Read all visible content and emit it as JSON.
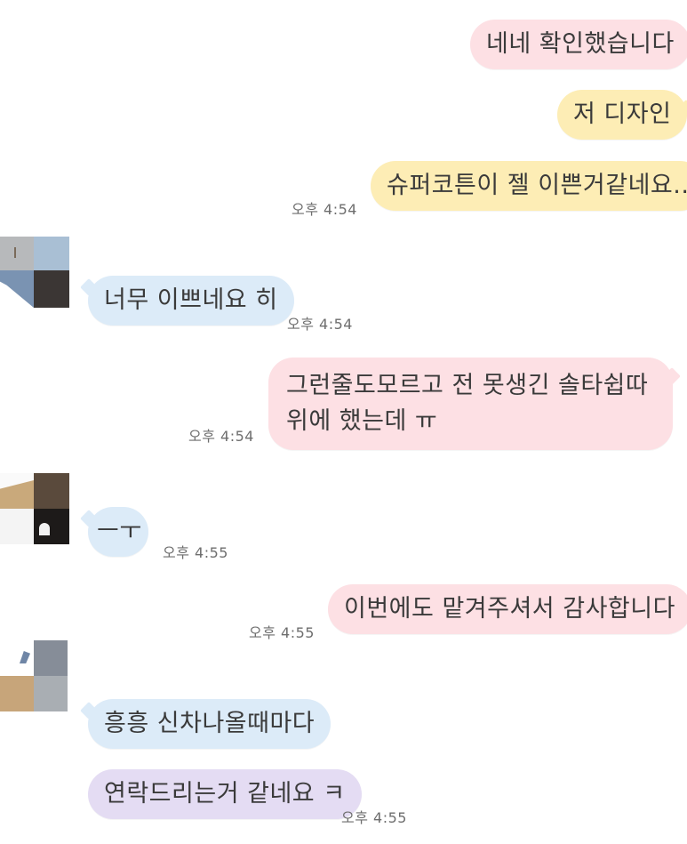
{
  "messages": [
    {
      "id": "m1",
      "side": "right",
      "text": "네네 확인했습니다"
    },
    {
      "id": "m2",
      "side": "right",
      "text": "저 디자인"
    },
    {
      "id": "m3",
      "side": "right",
      "text": "슈퍼코튼이 젤 이쁜거같네요..",
      "time": "오후 4:54"
    },
    {
      "id": "m4",
      "side": "left",
      "text": "너무 이쁘네요 히",
      "time": "오후 4:54"
    },
    {
      "id": "m5",
      "side": "right",
      "text": "그런줄도모르고 전 못생긴 솔타쉽따위에 했는데 ㅠ",
      "time": "오후 4:54"
    },
    {
      "id": "m6",
      "side": "left",
      "text": "ㅡㅜ",
      "time": "오후 4:55"
    },
    {
      "id": "m7",
      "side": "right",
      "text": "이번에도 맡겨주셔서 감사합니다",
      "time": "오후 4:55"
    },
    {
      "id": "m8",
      "side": "left",
      "text": "흥흥 신차나올때마다"
    },
    {
      "id": "m9",
      "side": "left",
      "text": "연락드리는거 같네요 ㅋ",
      "time": "오후 4:55"
    }
  ],
  "colors": {
    "pink": "#fde0e4",
    "yellow": "#fdedb5",
    "blue": "#dcebf8",
    "purple": "#e4dcf3",
    "timestamp": "#6e6e6e",
    "text": "#3a3a3a"
  },
  "avatars": [
    {
      "id": "avatar-1",
      "description": "pixelated-profile-photo"
    },
    {
      "id": "avatar-2",
      "description": "pixelated-profile-photo"
    },
    {
      "id": "avatar-3",
      "description": "pixelated-profile-photo"
    }
  ]
}
